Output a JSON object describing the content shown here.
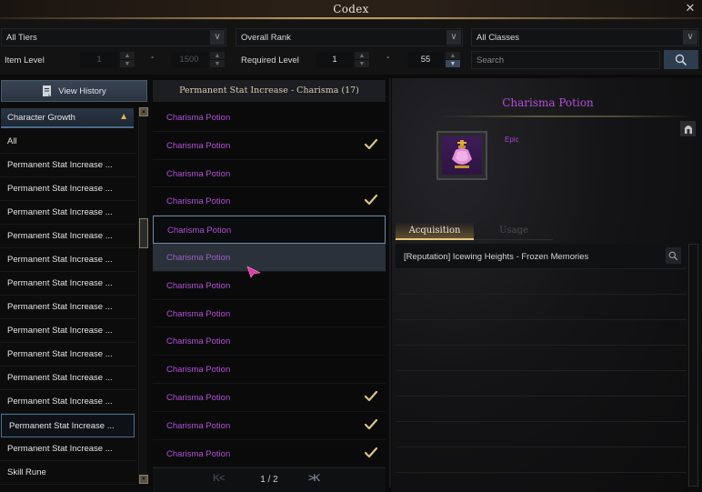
{
  "window": {
    "title": "Codex",
    "close_icon": "close-icon"
  },
  "filters": {
    "tier_select": "All Tiers",
    "rank_select": "Overall Rank",
    "class_select": "All Classes",
    "item_level_label": "Item Level",
    "item_level_min": "1",
    "item_level_max": "1500",
    "required_level_label": "Required Level",
    "required_level_min": "1",
    "required_level_max": "55",
    "range_dash": "-",
    "search_placeholder": "Search",
    "search_value": ""
  },
  "sidebar": {
    "view_history": "View History",
    "category_header": "Character Growth",
    "items": [
      {
        "label": "All",
        "selected": false
      },
      {
        "label": "Permanent Stat Increase ...",
        "selected": false
      },
      {
        "label": "Permanent Stat Increase ...",
        "selected": false
      },
      {
        "label": "Permanent Stat Increase ...",
        "selected": false
      },
      {
        "label": "Permanent Stat Increase ...",
        "selected": false
      },
      {
        "label": "Permanent Stat Increase ...",
        "selected": false
      },
      {
        "label": "Permanent Stat Increase ...",
        "selected": false
      },
      {
        "label": "Permanent Stat Increase ...",
        "selected": false
      },
      {
        "label": "Permanent Stat Increase ...",
        "selected": false
      },
      {
        "label": "Permanent Stat Increase ...",
        "selected": false
      },
      {
        "label": "Permanent Stat Increase ...",
        "selected": false
      },
      {
        "label": "Permanent Stat Increase ...",
        "selected": false
      },
      {
        "label": "Permanent Stat Increase ...",
        "selected": true
      },
      {
        "label": "Permanent Stat Increase ...",
        "selected": false
      },
      {
        "label": "Skill Rune",
        "selected": false
      }
    ]
  },
  "list": {
    "header": "Permanent Stat Increase - Charisma (17)",
    "items": [
      {
        "name": "Charisma Potion",
        "collected": false,
        "state": ""
      },
      {
        "name": "Charisma Potion",
        "collected": true,
        "state": ""
      },
      {
        "name": "Charisma Potion",
        "collected": false,
        "state": ""
      },
      {
        "name": "Charisma Potion",
        "collected": true,
        "state": ""
      },
      {
        "name": "Charisma Potion",
        "collected": false,
        "state": "focused"
      },
      {
        "name": "Charisma Potion",
        "collected": false,
        "state": "hover"
      },
      {
        "name": "Charisma Potion",
        "collected": false,
        "state": ""
      },
      {
        "name": "Charisma Potion",
        "collected": false,
        "state": ""
      },
      {
        "name": "Charisma Potion",
        "collected": false,
        "state": ""
      },
      {
        "name": "Charisma Potion",
        "collected": false,
        "state": ""
      },
      {
        "name": "Charisma Potion",
        "collected": true,
        "state": ""
      },
      {
        "name": "Charisma Potion",
        "collected": true,
        "state": ""
      },
      {
        "name": "Charisma Potion",
        "collected": true,
        "state": ""
      }
    ],
    "pager": {
      "first_prev": "K<",
      "page": "1 / 2",
      "next_last": ">K"
    }
  },
  "detail": {
    "name": "Charisma Potion",
    "grade": "Epic",
    "tabs": {
      "acquisition": "Acquisition",
      "usage": "Usage"
    },
    "acquisition": [
      "[Reputation] Icewing Heights - Frozen Memories"
    ],
    "colors": {
      "epic": "#b04fd9",
      "check": "#d9c38a",
      "accent_gold": "#e8c77c"
    }
  }
}
